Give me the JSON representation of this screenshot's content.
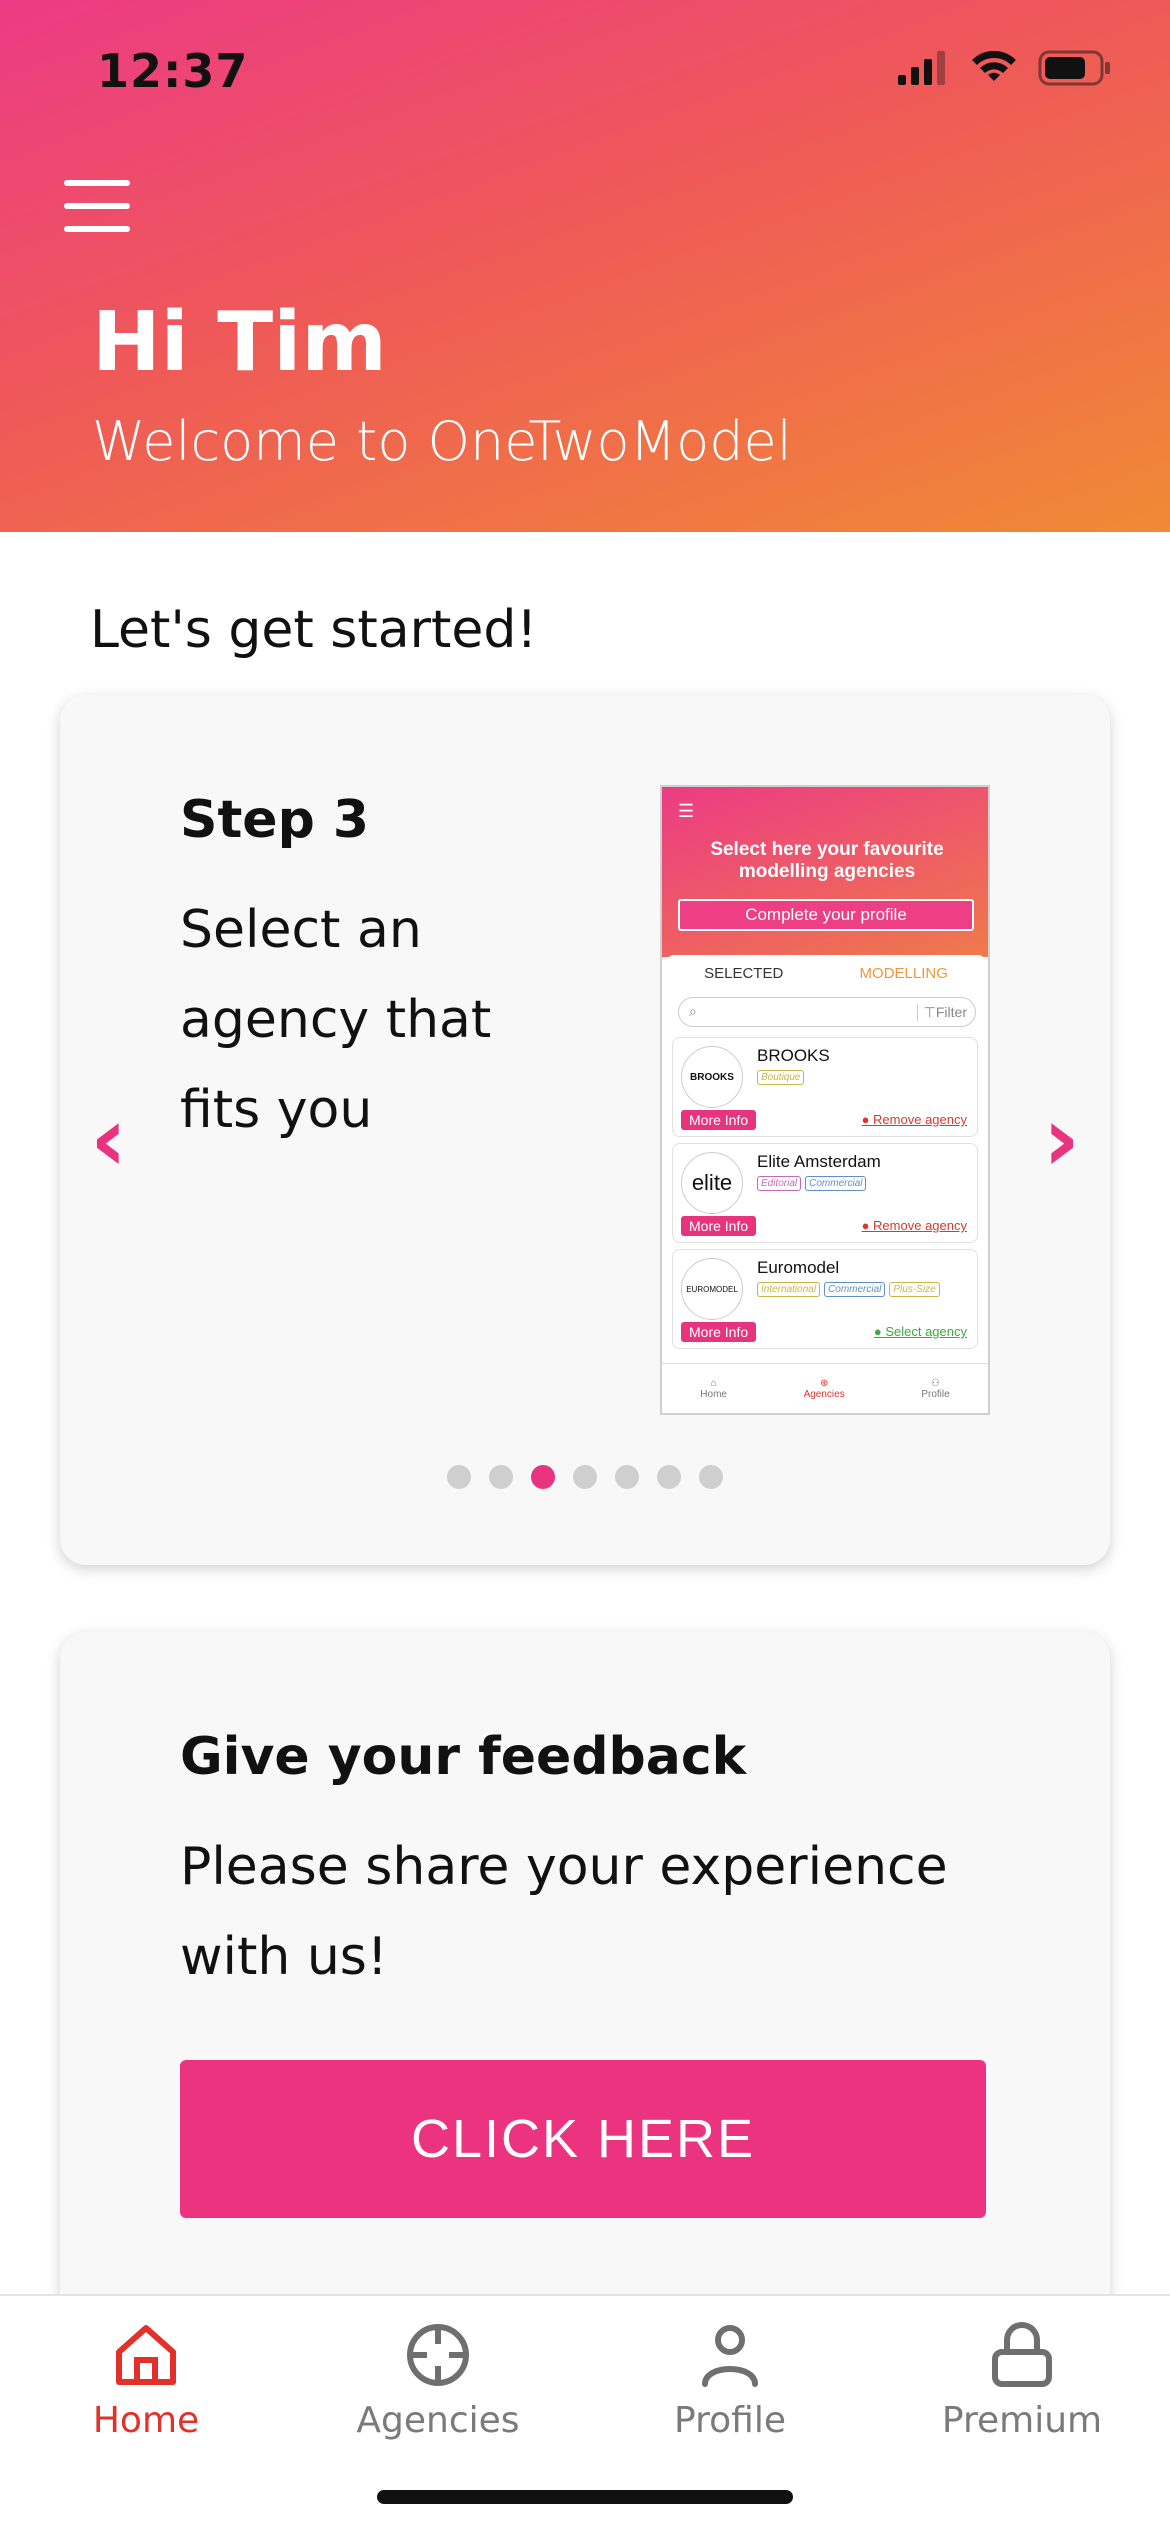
{
  "status_bar": {
    "time": "12:37"
  },
  "header": {
    "greeting": "Hi Tim",
    "welcome": "Welcome to OneTwoModel"
  },
  "intro": {
    "title": "Let's get started!"
  },
  "step_card": {
    "title": "Step 3",
    "description": "Select an agency that fits you",
    "prev_icon": "chevron-left-icon",
    "next_icon": "chevron-right-icon",
    "dots_total": 7,
    "active_dot": 3,
    "preview": {
      "title": "Select here your favourite modelling agencies",
      "button": "Complete your profile",
      "tabs": [
        "SELECTED",
        "MODELLING"
      ],
      "filter": "Filter",
      "agencies": [
        {
          "name": "BROOKS",
          "logo": "BROOKS",
          "tags": [
            "Boutique"
          ],
          "more": "More Info",
          "action": "Remove agency",
          "action_type": "remove"
        },
        {
          "name": "Elite Amsterdam",
          "logo": "elite",
          "tags": [
            "Editorial",
            "Commercial"
          ],
          "more": "More Info",
          "action": "Remove agency",
          "action_type": "remove"
        },
        {
          "name": "Euromodel",
          "logo": "EUROMODEL",
          "tags": [
            "International",
            "Commercial",
            "Plus-Size"
          ],
          "more": "More Info",
          "action": "Select agency",
          "action_type": "select"
        }
      ],
      "nav": [
        "Home",
        "Agencies",
        "Profile"
      ]
    }
  },
  "feedback_card": {
    "title": "Give your feedback",
    "description": "Please share your experience with us!",
    "button": "CLICK HERE"
  },
  "bottom_nav": {
    "items": [
      {
        "label": "Home",
        "icon": "home-icon",
        "active": true
      },
      {
        "label": "Agencies",
        "icon": "crosshair-icon",
        "active": false
      },
      {
        "label": "Profile",
        "icon": "person-icon",
        "active": false
      },
      {
        "label": "Premium",
        "icon": "lock-icon",
        "active": false
      }
    ]
  },
  "colors": {
    "accent": "#e8337e",
    "header_gradient_start": "#ec3b84",
    "header_gradient_end": "#f08a35",
    "nav_active": "#e2312b"
  }
}
